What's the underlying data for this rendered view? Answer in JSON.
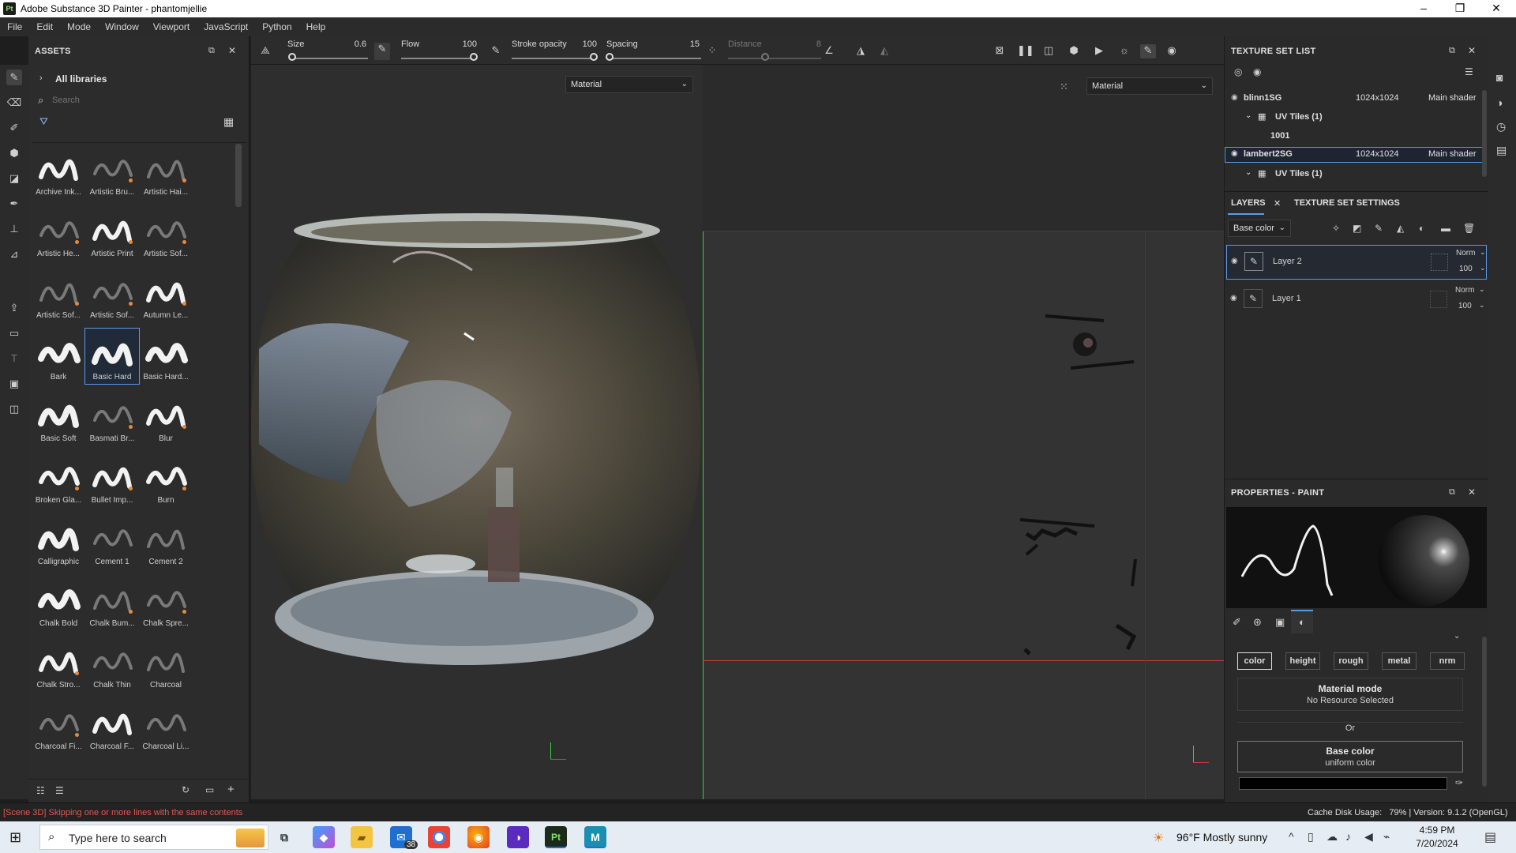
{
  "window": {
    "app_icon": "Pt",
    "title": "Adobe Substance 3D Painter - phantomjellie",
    "minimize": "–",
    "maximize": "❐",
    "close": "✕"
  },
  "menu": [
    "File",
    "Edit",
    "Mode",
    "Window",
    "Viewport",
    "JavaScript",
    "Python",
    "Help"
  ],
  "assets": {
    "title": "ASSETS",
    "library": "All libraries",
    "search_placeholder": "Search",
    "brushes": [
      {
        "label": "Archive Ink...",
        "selected": false
      },
      {
        "label": "Artistic Bru...",
        "selected": false
      },
      {
        "label": "Artistic Hai...",
        "selected": false
      },
      {
        "label": "Artistic He...",
        "selected": false
      },
      {
        "label": "Artistic Print",
        "selected": false
      },
      {
        "label": "Artistic Sof...",
        "selected": false
      },
      {
        "label": "Artistic Sof...",
        "selected": false
      },
      {
        "label": "Artistic Sof...",
        "selected": false
      },
      {
        "label": "Autumn Le...",
        "selected": false
      },
      {
        "label": "Bark",
        "selected": false
      },
      {
        "label": "Basic Hard",
        "selected": true
      },
      {
        "label": "Basic Hard...",
        "selected": false
      },
      {
        "label": "Basic Soft",
        "selected": false
      },
      {
        "label": "Basmati Br...",
        "selected": false
      },
      {
        "label": "Blur",
        "selected": false
      },
      {
        "label": "Broken Gla...",
        "selected": false
      },
      {
        "label": "Bullet Imp...",
        "selected": false
      },
      {
        "label": "Burn",
        "selected": false
      },
      {
        "label": "Calligraphic",
        "selected": false
      },
      {
        "label": "Cement 1",
        "selected": false
      },
      {
        "label": "Cement 2",
        "selected": false
      },
      {
        "label": "Chalk Bold",
        "selected": false
      },
      {
        "label": "Chalk Bum...",
        "selected": false
      },
      {
        "label": "Chalk Spre...",
        "selected": false
      },
      {
        "label": "Chalk Stro...",
        "selected": false
      },
      {
        "label": "Chalk Thin",
        "selected": false
      },
      {
        "label": "Charcoal",
        "selected": false
      },
      {
        "label": "Charcoal Fi...",
        "selected": false
      },
      {
        "label": "Charcoal F...",
        "selected": false
      },
      {
        "label": "Charcoal Li...",
        "selected": false
      }
    ]
  },
  "toolbar": {
    "size_label": "Size",
    "size_value": "0.6",
    "size_level": 0.02,
    "flow_label": "Flow",
    "flow_value": "100",
    "flow_level": 1.0,
    "opacity_label": "Stroke opacity",
    "opacity_value": "100",
    "opacity_level": 1.0,
    "spacing_label": "Spacing",
    "spacing_value": "15",
    "spacing_level": 0.03,
    "distance_label": "Distance",
    "distance_value": "8",
    "distance_level": 0.4
  },
  "viewport3d": {
    "mode": "Material"
  },
  "viewport2d": {
    "mode": "Material"
  },
  "texture_set_list": {
    "title": "TEXTURE SET LIST",
    "sets": [
      {
        "name": "blinn1SG",
        "resolution": "1024x1024",
        "shader": "Main shader",
        "uv_label": "UV Tiles (1)",
        "tile": "1001"
      },
      {
        "name": "lambert2SG",
        "resolution": "1024x1024",
        "shader": "Main shader",
        "uv_label": "UV Tiles (1)"
      }
    ]
  },
  "layers_panel": {
    "tab_layers": "LAYERS",
    "tab_settings": "TEXTURE SET SETTINGS",
    "channel": "Base color",
    "layers": [
      {
        "name": "Layer 2",
        "blend": "Norm",
        "opacity": "100"
      },
      {
        "name": "Layer 1",
        "blend": "Norm",
        "opacity": "100"
      }
    ]
  },
  "properties": {
    "title": "PROPERTIES - PAINT",
    "channels": [
      "color",
      "height",
      "rough",
      "metal",
      "nrm"
    ],
    "material_mode_title": "Material mode",
    "material_mode_sub": "No Resource Selected",
    "or": "Or",
    "base_color_title": "Base color",
    "base_color_sub": "uniform color"
  },
  "status": {
    "message": "[Scene 3D] Skipping one or more lines with the same contents",
    "cache": "Cache Disk Usage:   79% | Version: 9.1.2 (OpenGL)"
  },
  "taskbar": {
    "search_placeholder": "Type here to search",
    "mail_badge": "38",
    "weather": "96°F  Mostly sunny",
    "time": "4:59 PM",
    "date": "7/20/2024"
  },
  "colors": {
    "accent": "#5b9ae8",
    "status_error": "#e05a4a",
    "axis_green": "#3ad13a",
    "axis_red": "#d13a3a"
  }
}
